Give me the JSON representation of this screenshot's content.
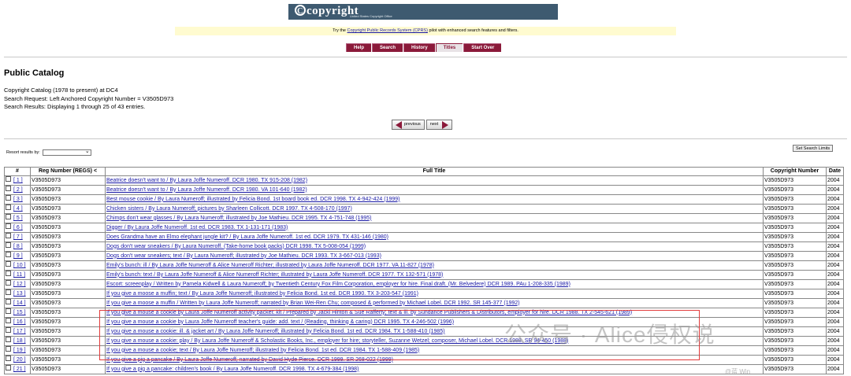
{
  "banner": {
    "logo": "copyright",
    "sub": "United States Copyright Office"
  },
  "notice": {
    "before": "Try the ",
    "link": "Copyright Public Records System (CPRS)",
    "after": " pilot with enhanced search features and filters."
  },
  "menu": [
    {
      "label": "Help",
      "active": false
    },
    {
      "label": "Search",
      "active": false
    },
    {
      "label": "History",
      "active": false
    },
    {
      "label": "Titles",
      "active": true
    },
    {
      "label": "Start Over",
      "active": false
    }
  ],
  "page": {
    "title": "Public Catalog",
    "catalog": "Copyright Catalog (1978 to present) at DC4",
    "request": "Search Request: Left Anchored Copyright Number = V3505D973",
    "results": "Search Results: Displaying 1 through 25 of 43 entries."
  },
  "pager": {
    "previous": "previous",
    "next": "next"
  },
  "sort": {
    "label": "Resort results by:",
    "selected": ""
  },
  "limits_button": "Set Search Limits",
  "table": {
    "headers": [
      "#",
      "Reg Number (REGS) <",
      "Full Title",
      "Copyright Number",
      "Date"
    ],
    "rows": [
      {
        "n": "[ 1 ]",
        "reg": "V3505D973",
        "title": "Beatrice doesn't want to / By Laura Joffe Numeroff. DCR 1980. TX 915-208 (1982)",
        "cn": "V3505D973",
        "date": "2004"
      },
      {
        "n": "[ 2 ]",
        "reg": "V3505D973",
        "title": "Beatrice doesn't want to / By Laura Joffe Numeroff. DCR 1980. VA 101-640 (1982)",
        "cn": "V3505D973",
        "date": "2004"
      },
      {
        "n": "[ 3 ]",
        "reg": "V3505D973",
        "title": "Best mouse cookie / By Laura Numeroff; illustrated by Felicia Bond. 1st board book ed. DCR 1998. TX 4-942-424 (1999)",
        "cn": "V3505D973",
        "date": "2004"
      },
      {
        "n": "[ 4 ]",
        "reg": "V3505D973",
        "title": "Chicken sisters / By Laura Numeroff; pictures by Sharleen Collicott. DCR 1997. TX 4-508-170 (1997)",
        "cn": "V3505D973",
        "date": "2004"
      },
      {
        "n": "[ 5 ]",
        "reg": "V3505D973",
        "title": "Chimps don't wear glasses / By Laura Numeroff; illustrated by Joe Mathieu. DCR 1995. TX 4-751-748 (1995)",
        "cn": "V3505D973",
        "date": "2004"
      },
      {
        "n": "[ 6 ]",
        "reg": "V3505D973",
        "title": "Digger / By Laura Joffe Numeroff. 1st ed. DCR 1983. TX 1-131-171 (1983)",
        "cn": "V3505D973",
        "date": "2004"
      },
      {
        "n": "[ 7 ]",
        "reg": "V3505D973",
        "title": "Does Grandma have an Elmo elephant jungle kit? / By Laura Joffe Numeroff. 1st ed. DCR 1979. TX 431-146 (1980)",
        "cn": "V3505D973",
        "date": "2004"
      },
      {
        "n": "[ 8 ]",
        "reg": "V3505D973",
        "title": "Dogs don't wear sneakers / By Laura Numeroff. (Take-home book packs) DCR 1998. TX 5-008-054 (1999)",
        "cn": "V3505D973",
        "date": "2004"
      },
      {
        "n": "[ 9 ]",
        "reg": "V3505D973",
        "title": "Dogs don't wear sneakers; text / By Laura Numeroff; illustrated by Joe Mathieu. DCR 1993. TX 3-667-013 (1993)",
        "cn": "V3505D973",
        "date": "2004"
      },
      {
        "n": "[ 10 ]",
        "reg": "V3505D973",
        "title": "Emily's bunch: ill / By Laura Joffe Numeroff & Alice Numeroff Richter; illustrated by Laura Joffe Numeroff. DCR 1977. VA 11-827 (1978)",
        "cn": "V3505D973",
        "date": "2004"
      },
      {
        "n": "[ 11 ]",
        "reg": "V3505D973",
        "title": "Emily's bunch: text / By Laura Joffe Numeroff & Alice Numeroff Richter; illustrated by Laura Joffe Numeroff. DCR 1977. TX 132-571 (1978)",
        "cn": "V3505D973",
        "date": "2004"
      },
      {
        "n": "[ 12 ]",
        "reg": "V3505D973",
        "title": "Escort: screenplay / Written by Pamela Kidwell & Laura Numeroff; by Twentieth Century Fox Film Corporation, employer for hire. Final draft. (Mr. Belvedere) DCR 1989. PAu 1-208-335 (1989)",
        "cn": "V3505D973",
        "date": "2004"
      },
      {
        "n": "[ 13 ]",
        "reg": "V3505D973",
        "title": "If you give a moose a muffin; text / By Laura Joffe Numeroff; illustrated by Felicia Bond. 1st ed. DCR 1990. TX 3-203-547 (1991)",
        "cn": "V3505D973",
        "date": "2004"
      },
      {
        "n": "[ 14 ]",
        "reg": "V3505D973",
        "title": "If you give a moose a muffin / Written by Laura Joffe Numeroff; narrated by Brian Wei-Ren Chu; composed & performed by Michael Lobel. DCR 1992. SR 145-377 (1992)",
        "cn": "V3505D973",
        "date": "2004"
      },
      {
        "n": "[ 15 ]",
        "reg": "V3505D973",
        "title": "If you give a mouse a cookie by Laura Joffe Numeroff activity packet: kit / Prepared by Jacki Hinton & Sue Rafferty; text & ill. by Sundance Publishers & Distributors, employer for hire. DCR 1988. TX 2-545-621 (1989)",
        "cn": "V3505D973",
        "date": "2004"
      },
      {
        "n": "[ 16 ]",
        "reg": "V3505D973",
        "title": "If you give a mouse a cookie by Laura Joffe Numeroff teacher's guide: add. text / (Reading, thinking & caring) DCR 1995. TX 4-246-502 (1996)",
        "cn": "V3505D973",
        "date": "2004"
      },
      {
        "n": "[ 17 ]",
        "reg": "V3505D973",
        "title": "If you give a mouse a cookie: ill. & jacket art / By Laura Joffe Numeroff; illustrated by Felicia Bond. 1st ed. DCR 1984. TX 1-588-410 (1985)",
        "cn": "V3505D973",
        "date": "2004"
      },
      {
        "n": "[ 18 ]",
        "reg": "V3505D973",
        "title": "If you give a mouse a cookie: play / By Laura Joffe Numeroff & Scholastic Books, Inc., employer for hire; storyteller, Suzanne Wetzel; composer, Michael Lobel. DCR 1988. SR 94-450 (1988)",
        "cn": "V3505D973",
        "date": "2004"
      },
      {
        "n": "[ 19 ]",
        "reg": "V3505D973",
        "title": "If you give a mouse a cookie; text / By Laura Joffe Numeroff; illustrated by Felicia Bond. 1st ed. DCR 1984. TX 1-588-409 (1985)",
        "cn": "V3505D973",
        "date": "2004"
      },
      {
        "n": "[ 20 ]",
        "reg": "V3505D973",
        "title": "If you give a pig a pancake / By Laura Joffe Numeroff; narrated by David Hyde Pierce. DCR 1999. SR 268-022 (1999)",
        "cn": "V3505D973",
        "date": "2004"
      },
      {
        "n": "[ 21 ]",
        "reg": "V3505D973",
        "title": "If you give a pig a pancake: children's book / By Laura Joffe Numeroff. DCR 1998. TX 4-679-384 (1998)",
        "cn": "V3505D973",
        "date": "2004"
      }
    ]
  },
  "watermark": {
    "text": "公众号 · Alice侵权说",
    "corner": "@蓝 Win"
  },
  "colors": {
    "menu": "#8b1a3a",
    "link": "#1a1aa6",
    "highlight": "#e23b3b",
    "banner": "#3e5a70",
    "notice": "#fffbd0"
  }
}
